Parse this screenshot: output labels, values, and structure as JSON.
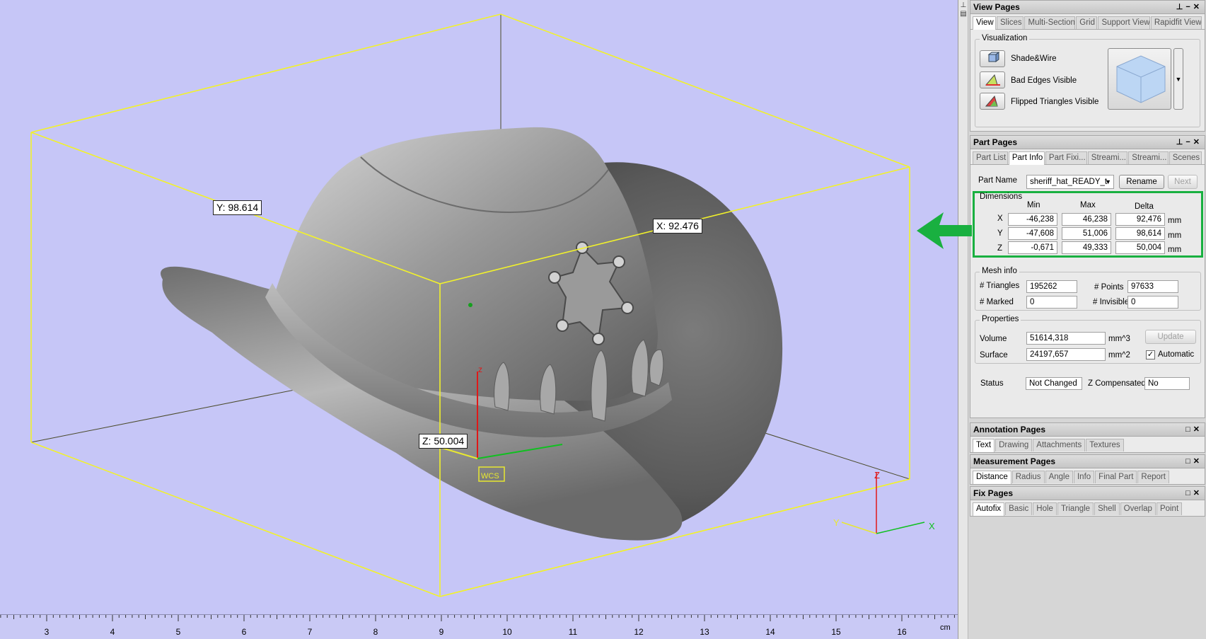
{
  "viewport": {
    "labels": {
      "y_dim": "Y: 98.614",
      "x_dim": "X: 92.476",
      "z_dim": "Z: 50.004",
      "wcs": "WCS"
    },
    "axes": {
      "x": "X",
      "y": "Y",
      "z": "Z",
      "z_origin": "z"
    },
    "ruler": {
      "ticks": [
        "3",
        "4",
        "5",
        "6",
        "7",
        "8",
        "9",
        "10",
        "11",
        "12",
        "13",
        "14",
        "15",
        "16"
      ],
      "unit": "cm"
    }
  },
  "view_pages": {
    "title": "View Pages",
    "tabs": [
      "View",
      "Slices",
      "Multi-Section",
      "Grid",
      "Support View",
      "Rapidfit View"
    ],
    "visualization": {
      "title": "Visualization",
      "items": [
        {
          "label": "Shade&Wire",
          "icon": "cube-shade-icon"
        },
        {
          "label": "Bad Edges Visible",
          "icon": "bad-edges-icon"
        },
        {
          "label": "Flipped Triangles Visible",
          "icon": "flipped-triangles-icon"
        }
      ]
    }
  },
  "part_pages": {
    "title": "Part Pages",
    "tabs": [
      "Part List",
      "Part Info",
      "Part Fixi...",
      "Streami...",
      "Streami...",
      "Scenes"
    ],
    "part_name_label": "Part Name",
    "part_name_value": "sheriff_hat_READY_t",
    "rename_label": "Rename",
    "next_label": "Next",
    "dimensions": {
      "title": "Dimensions",
      "headers": [
        "Min",
        "Max",
        "Delta"
      ],
      "rows": [
        {
          "axis": "X",
          "min": "-46,238",
          "max": "46,238",
          "delta": "92,476",
          "unit": "mm"
        },
        {
          "axis": "Y",
          "min": "-47,608",
          "max": "51,006",
          "delta": "98,614",
          "unit": "mm"
        },
        {
          "axis": "Z",
          "min": "-0,671",
          "max": "49,333",
          "delta": "50,004",
          "unit": "mm"
        }
      ]
    },
    "mesh_info": {
      "title": "Mesh info",
      "triangles_label": "# Triangles",
      "triangles": "195262",
      "points_label": "# Points",
      "points": "97633",
      "marked_label": "# Marked",
      "marked": "0",
      "invisible_label": "# Invisible",
      "invisible": "0"
    },
    "properties": {
      "title": "Properties",
      "volume_label": "Volume",
      "volume": "51614,318",
      "volume_unit": "mm^3",
      "surface_label": "Surface",
      "surface": "24197,657",
      "surface_unit": "mm^2",
      "update_label": "Update",
      "automatic_label": "Automatic",
      "automatic_checked": "✓"
    },
    "status_label": "Status",
    "status": "Not Changed",
    "zcomp_label": "Z Compensated",
    "zcomp": "No"
  },
  "annotation_pages": {
    "title": "Annotation Pages",
    "tabs": [
      "Text",
      "Drawing",
      "Attachments",
      "Textures"
    ]
  },
  "measurement_pages": {
    "title": "Measurement Pages",
    "tabs": [
      "Distance",
      "Radius",
      "Angle",
      "Info",
      "Final Part",
      "Report"
    ]
  },
  "fix_pages": {
    "title": "Fix Pages",
    "tabs": [
      "Autofix",
      "Basic",
      "Hole",
      "Triangle",
      "Shell",
      "Overlap",
      "Point"
    ]
  },
  "colors": {
    "viewport_bg": "#c6c6f7",
    "bbox": "#f2f22a",
    "highlight": "#19b040"
  }
}
